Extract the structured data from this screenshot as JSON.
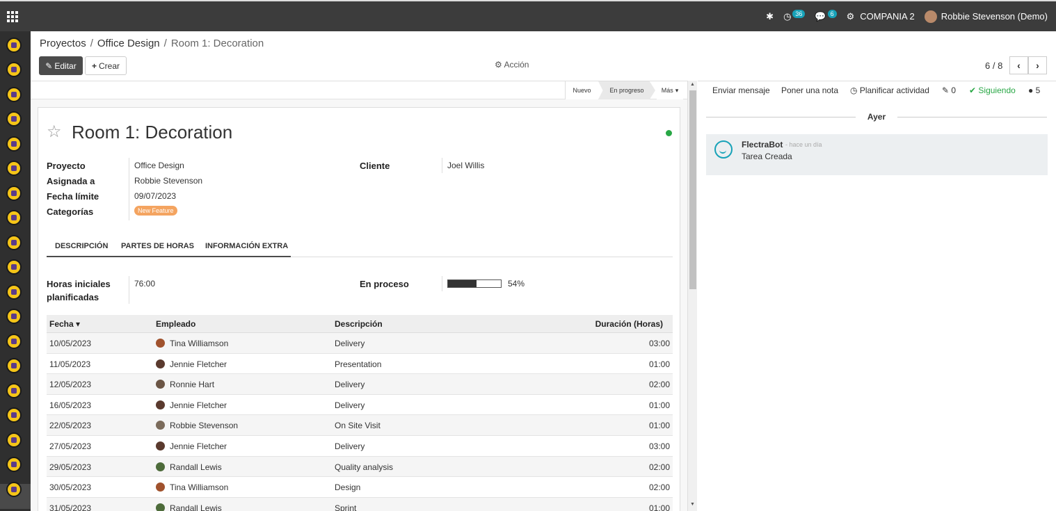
{
  "topbar": {
    "activities_count": "36",
    "messages_count": "6",
    "company": "COMPANIA 2",
    "user": "Robbie Stevenson (Demo)"
  },
  "breadcrumb": [
    "Proyectos",
    "Office Design",
    "Room 1: Decoration"
  ],
  "control": {
    "edit_label": "Editar",
    "create_label": "Crear",
    "action_label": "Acción",
    "pager": "6 / 8"
  },
  "stages": {
    "nuevo": "Nuevo",
    "en_progreso": "En progreso",
    "mas": "Más"
  },
  "task": {
    "title": "Room 1: Decoration",
    "fields": {
      "proyecto_label": "Proyecto",
      "proyecto": "Office Design",
      "asignada_label": "Asignada a",
      "asignada": "Robbie Stevenson",
      "fecha_label": "Fecha límite",
      "fecha": "09/07/2023",
      "categorias_label": "Categorías",
      "categoria_tag": "New Feature",
      "cliente_label": "Cliente",
      "cliente": "Joel Willis"
    },
    "tabs": [
      "DESCRIPCIÓN",
      "PARTES DE HORAS",
      "INFORMACIÓN EXTRA"
    ],
    "horas_label_1": "Horas iniciales",
    "horas_label_2": "planificadas",
    "horas_value": "76:00",
    "proceso_label": "En proceso",
    "proceso_value": "54%",
    "proceso_fraction": 0.54
  },
  "timesheet": {
    "headers": [
      "Fecha",
      "Empleado",
      "Descripción",
      "Duración (Horas)"
    ],
    "rows": [
      {
        "date": "10/05/2023",
        "employee": "Tina Williamson",
        "desc": "Delivery",
        "dur": "03:00"
      },
      {
        "date": "11/05/2023",
        "employee": "Jennie Fletcher",
        "desc": "Presentation",
        "dur": "01:00"
      },
      {
        "date": "12/05/2023",
        "employee": "Ronnie Hart",
        "desc": "Delivery",
        "dur": "02:00"
      },
      {
        "date": "16/05/2023",
        "employee": "Jennie Fletcher",
        "desc": "Delivery",
        "dur": "01:00"
      },
      {
        "date": "22/05/2023",
        "employee": "Robbie Stevenson",
        "desc": "On Site Visit",
        "dur": "01:00"
      },
      {
        "date": "27/05/2023",
        "employee": "Jennie Fletcher",
        "desc": "Delivery",
        "dur": "03:00"
      },
      {
        "date": "29/05/2023",
        "employee": "Randall Lewis",
        "desc": "Quality analysis",
        "dur": "02:00"
      },
      {
        "date": "30/05/2023",
        "employee": "Tina Williamson",
        "desc": "Design",
        "dur": "02:00"
      },
      {
        "date": "31/05/2023",
        "employee": "Randall Lewis",
        "desc": "Sprint",
        "dur": "01:00"
      }
    ]
  },
  "chatter": {
    "send_message": "Enviar mensaje",
    "log_note": "Poner una nota",
    "schedule": "Planificar actividad",
    "attachments": "0",
    "following": "Siguiendo",
    "followers": "5",
    "date_separator": "Ayer",
    "message": {
      "author": "FlectraBot",
      "time": "- hace un día",
      "body": "Tarea Creada"
    }
  }
}
